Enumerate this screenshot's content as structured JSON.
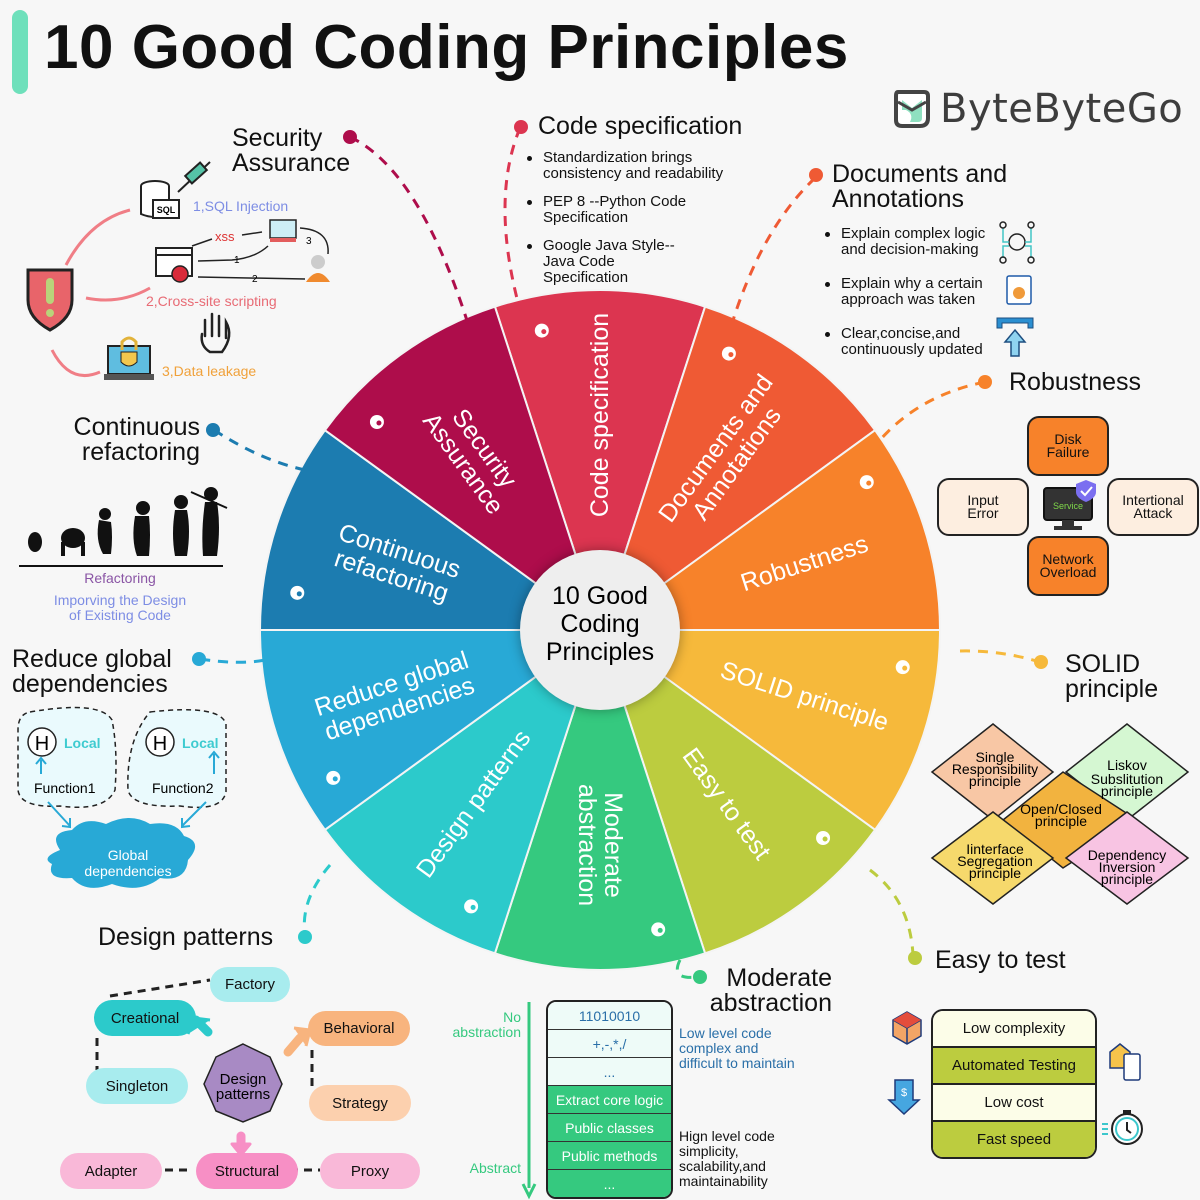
{
  "header": {
    "title": "10 Good Coding Principles",
    "brand": "ByteByteGo",
    "accent_color": "#6ee0bb"
  },
  "wheel": {
    "center_label": [
      "10 Good",
      "Coding",
      "Principles"
    ],
    "segments": [
      {
        "id": "code-specification",
        "label": [
          "Code specification"
        ],
        "color": "#dc3550"
      },
      {
        "id": "documents-annotations",
        "label": [
          "Documents and",
          "Annotations"
        ],
        "color": "#ef5a34"
      },
      {
        "id": "robustness",
        "label": [
          "Robustness"
        ],
        "color": "#f7822a"
      },
      {
        "id": "solid-principle",
        "label": [
          "SOLID principle"
        ],
        "color": "#f6b93b"
      },
      {
        "id": "easy-to-test",
        "label": [
          "Easy to test"
        ],
        "color": "#bccc3f"
      },
      {
        "id": "moderate-abstraction",
        "label": [
          "Moderate",
          "abstraction"
        ],
        "color": "#35c97f"
      },
      {
        "id": "design-patterns",
        "label": [
          "Design patterns"
        ],
        "color": "#2ccacb"
      },
      {
        "id": "reduce-global-dependencies",
        "label": [
          "Reduce global",
          "dependencies"
        ],
        "color": "#28a9d6"
      },
      {
        "id": "continuous-refactoring",
        "label": [
          "Continuous",
          "refactoring"
        ],
        "color": "#1c7cb0"
      },
      {
        "id": "security-assurance",
        "label": [
          "Security",
          "Assurance"
        ],
        "color": "#ae0d4b"
      }
    ]
  },
  "security": {
    "title": [
      "Security",
      "Assurance"
    ],
    "items": [
      "1,SQL Injection",
      "2,Cross-site scripting",
      "3,Data leakage"
    ],
    "xss_label": "xss",
    "sql_label": "SQL",
    "step_labels": [
      "1",
      "2",
      "3"
    ]
  },
  "code_spec": {
    "title": "Code specification",
    "bullets": [
      [
        "Standardization brings",
        "consistency and readability"
      ],
      [
        "PEP 8 --Python Code",
        "Specification"
      ],
      [
        "Google Java Style--",
        "Java Code",
        "Specification"
      ]
    ]
  },
  "docs": {
    "title": [
      "Documents and",
      "Annotations"
    ],
    "bullets": [
      [
        "Explain complex logic",
        "and decision-making"
      ],
      [
        "Explain why a certain",
        "approach was taken"
      ],
      [
        "Clear,concise,and",
        "continuously updated"
      ]
    ]
  },
  "robustness": {
    "title": "Robustness",
    "top": [
      "Disk",
      "Failure"
    ],
    "left": [
      "Input",
      "Error"
    ],
    "right": [
      "Intertional",
      "Attack"
    ],
    "bottom": [
      "Network",
      "Overload"
    ],
    "center": "Service"
  },
  "solid": {
    "title": [
      "SOLID",
      "principle"
    ],
    "s": [
      "Single",
      "Responsibility",
      "principle"
    ],
    "l": [
      "Liskov",
      "Subslitution",
      "principle"
    ],
    "o": [
      "Open/Closed",
      "principle"
    ],
    "i": [
      "Iinterface",
      "Segregation",
      "principle"
    ],
    "d": [
      "Dependency",
      "Inversion",
      "principle"
    ]
  },
  "easy_test": {
    "title": "Easy to test",
    "rows": [
      "Low complexity",
      "Automated Testing",
      "Low cost",
      "Fast speed"
    ]
  },
  "abstraction": {
    "title": [
      "Moderate",
      "abstraction"
    ],
    "axis_top": [
      "No",
      "abstraction"
    ],
    "axis_bottom": "Abstract",
    "rows_low": [
      "11010010",
      "+,-,*,/",
      "..."
    ],
    "rows_high": [
      "Extract core logic",
      "Public classes",
      "Public methods",
      "..."
    ],
    "low_note": [
      "Low level code",
      "complex and",
      "difficult to maintain"
    ],
    "high_note": [
      "Hign level code",
      "simplicity,",
      "scalability,and",
      "maintainability"
    ]
  },
  "design_patterns": {
    "title": "Design patterns",
    "center": [
      "Design",
      "patterns"
    ],
    "creational": "Creational",
    "factory": "Factory",
    "singleton": "Singleton",
    "behavioral": "Behavioral",
    "strategy": "Strategy",
    "structural": "Structural",
    "adapter": "Adapter",
    "proxy": "Proxy"
  },
  "global_deps": {
    "title": [
      "Reduce global",
      "dependencies"
    ],
    "h": "H",
    "local": "Local",
    "functions": [
      "Function1",
      "Function2"
    ],
    "cloud": [
      "Global",
      "dependencies"
    ]
  },
  "refactoring": {
    "title": [
      "Continuous",
      "refactoring"
    ],
    "caption": "Refactoring",
    "sub": [
      "Imporving the Design",
      "of Existing Code"
    ]
  }
}
